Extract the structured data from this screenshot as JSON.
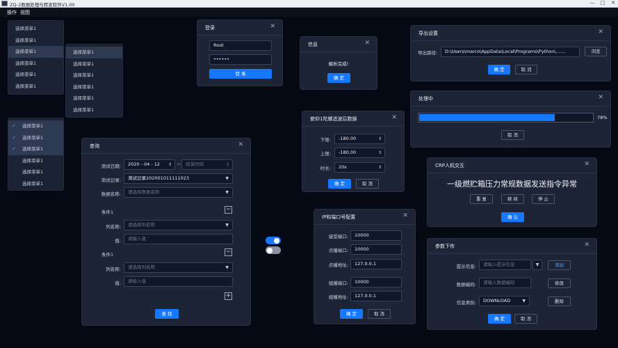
{
  "window": {
    "title": "ZQ-2数据处理与转发软件V1.00"
  },
  "menubar": {
    "items": [
      "操作",
      "视图"
    ]
  },
  "menu1": {
    "items": [
      "选择菜单1",
      "选择菜单1",
      "选择菜单1",
      "选择菜单1",
      "选择菜单1",
      "选择菜单1"
    ],
    "selected": 2
  },
  "menu2": {
    "items": [
      "选择菜单1",
      "选择菜单1",
      "选择菜单1",
      "选择菜单1",
      "选择菜单1",
      "选择菜单1"
    ],
    "selected": 0
  },
  "menu3": {
    "items": [
      "选择菜单1",
      "选择菜单1",
      "选择菜单1",
      "选择菜单1",
      "选择菜单1",
      "选择菜单1"
    ],
    "selected": [
      0,
      1,
      2
    ],
    "check": "✓"
  },
  "login": {
    "title": "登录",
    "username": "Root",
    "password": "••••••",
    "submit": "登 录"
  },
  "info": {
    "title": "信息",
    "message": "解析完成!",
    "ok": "确 定"
  },
  "export": {
    "title": "导出设置",
    "path_label": "导出路径:",
    "path_value": "D:\\Users\\marco\\AppData\\Local\\Programs\\Python\\.......",
    "browse": "浏览",
    "ok": "确 定",
    "cancel": "取 消"
  },
  "processing": {
    "title": "处理中",
    "percent_text": "78%",
    "progress": 0.78,
    "cancel": "取 消"
  },
  "filter": {
    "title": "俯仰1陀螺滤波后数据",
    "lower_label": "下限:",
    "lower_value": "-180.00",
    "upper_label": "上限:",
    "upper_value": "-180.00",
    "duration_label": "时长:",
    "duration_value": "20s",
    "ok": "确 定",
    "cancel": "取 消"
  },
  "crp": {
    "title": "CRP人机交互",
    "message": "一级燃贮箱压力常规数据发送指令异常",
    "btn_reset": "重 复",
    "btn_continue": "继 续",
    "btn_stop": "停 止",
    "confirm": "确 认"
  },
  "query": {
    "title": "查询",
    "date_label": "测试日期:",
    "date_value": "2020 - 04 - 12",
    "date_sep": "~",
    "end_placeholder": "结束时间",
    "record_label": "测试记录:",
    "record_value": "测试记录202001011111023",
    "db_label": "数据名称:",
    "db_placeholder": "请选择数据名称",
    "conditions": [
      {
        "title": "条件1",
        "col_label": "列名称:",
        "col_placeholder": "请选择列名称",
        "val_label": "值:",
        "val_placeholder": "请输入值"
      },
      {
        "title": "条件1",
        "col_label": "列名称:",
        "col_placeholder": "请选择列名称",
        "val_label": "值:",
        "val_placeholder": "请输入值"
      }
    ],
    "search": "查 找"
  },
  "ipconfig": {
    "title": "IP和端口号配置",
    "recv_port_label": "接受端口:",
    "recv_port": "10000",
    "bcast_port_label": "点播端口:",
    "bcast_port": "10000",
    "bcast_addr_label": "点播地址:",
    "bcast_addr": "127.0.0.1",
    "group_port_label": "组播端口:",
    "group_port": "10000",
    "group_addr_label": "组播地址:",
    "group_addr": "127.0.0.1",
    "ok": "确 定",
    "cancel": "取 消"
  },
  "params": {
    "title": "参数下传",
    "hint_label": "提示信息:",
    "hint_placeholder": "请输入提示信息",
    "add": "添加",
    "code_label": "数据编码:",
    "code_placeholder": "请输入数据编码",
    "modify": "修改",
    "type_label": "信息类别:",
    "type_value": "DOWNLOAD",
    "delete": "删除",
    "ok": "确 定",
    "cancel": "取 消"
  },
  "toggles": [
    {
      "on": true
    },
    {
      "on": false
    }
  ],
  "colors": {
    "accent": "#1677ff",
    "background": "#050914",
    "panel": "#1c2436"
  }
}
